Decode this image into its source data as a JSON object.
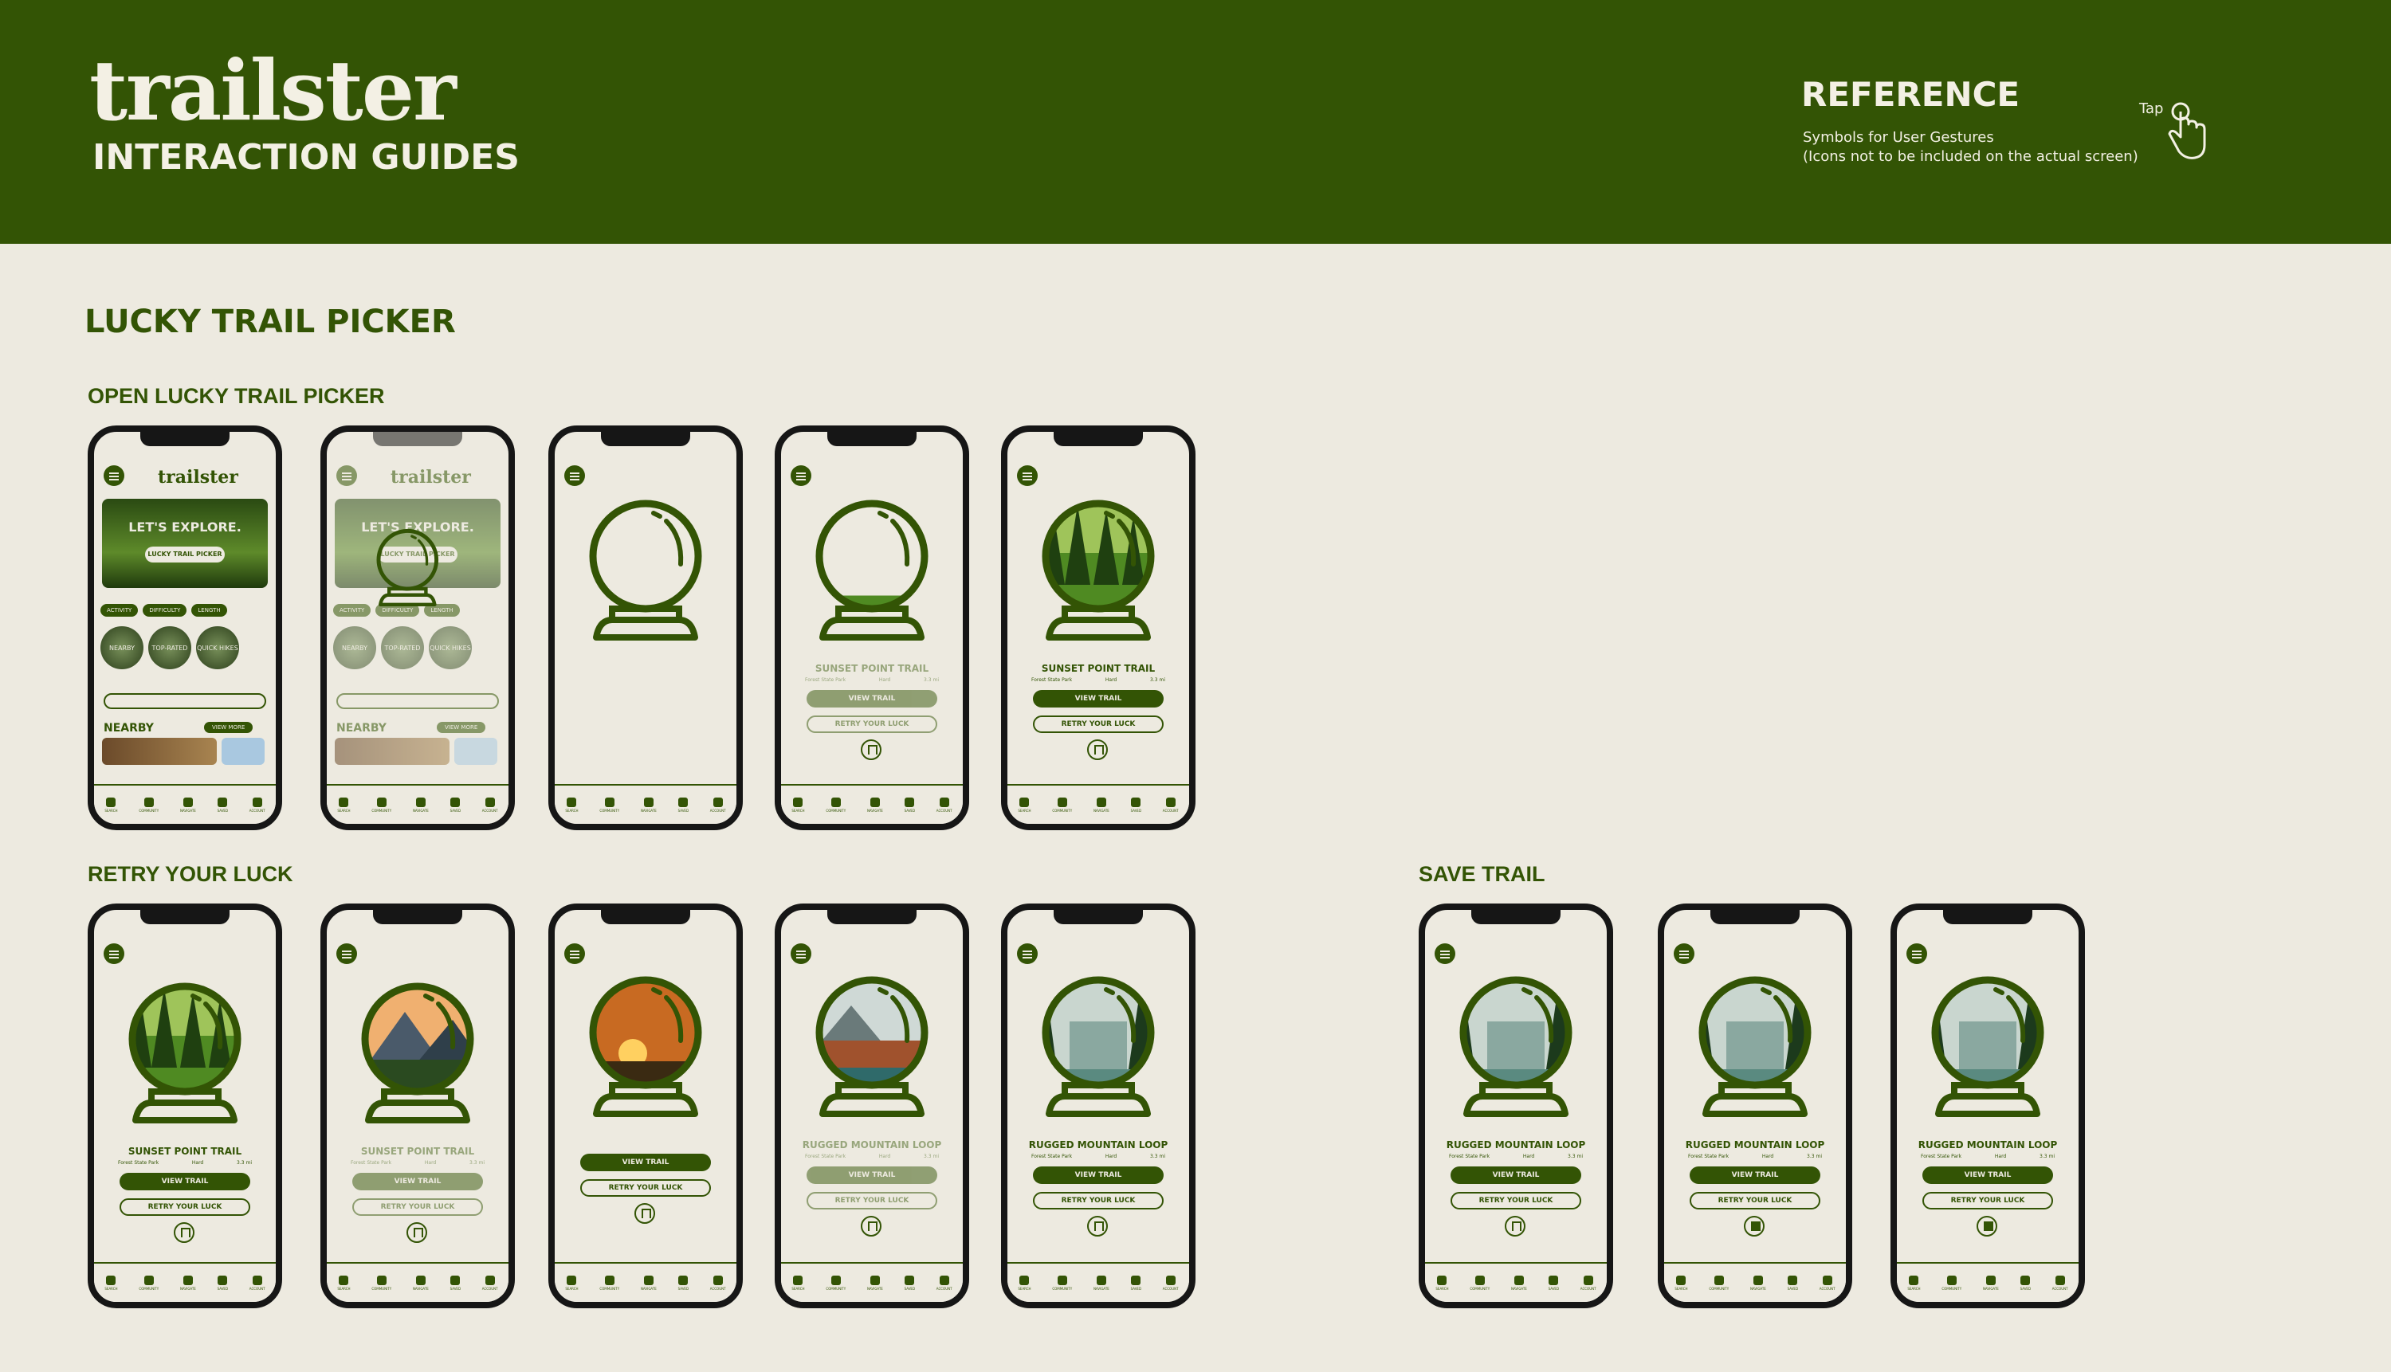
{
  "header": {
    "logo_text": "trailster",
    "subtitle": "INTERACTION GUIDES",
    "reference_title": "REFERENCE",
    "reference_line1": "Symbols for User Gestures",
    "reference_line2": "(Icons not to be included on the actual screen)",
    "gesture_label": "Tap"
  },
  "section_title": "LUCKY TRAIL PICKER",
  "row_labels": {
    "open": "OPEN LUCKY TRAIL PICKER",
    "retry": "RETRY YOUR LUCK",
    "save": "SAVE TRAIL"
  },
  "home": {
    "logo": "trailster",
    "hero_title": "LET'S EXPLORE.",
    "hero_button": "LUCKY TRAIL PICKER",
    "chips": [
      "ACTIVITY",
      "DIFFICULTY",
      "LENGTH"
    ],
    "circles": [
      "NEARBY",
      "TOP-RATED",
      "QUICK HIKES"
    ],
    "nearby": "NEARBY",
    "view_more": "VIEW MORE"
  },
  "trails": {
    "sunset": {
      "name": "SUNSET POINT TRAIL",
      "park": "Forest State Park",
      "difficulty": "Hard",
      "distance": "3.3 mi"
    },
    "rugged": {
      "name": "RUGGED MOUNTAIN LOOP",
      "park": "Forest State Park",
      "difficulty": "Hard",
      "distance": "3.3 mi"
    }
  },
  "buttons": {
    "view_trail": "VIEW TRAIL",
    "retry": "RETRY YOUR LUCK"
  },
  "tabbar": [
    "SEARCH",
    "COMMUNITY",
    "NAVIGATE",
    "SAVED",
    "ACCOUNT"
  ],
  "colors": {
    "brand_green": "#335405",
    "background": "#edeae0",
    "phone_frame": "#161616"
  }
}
